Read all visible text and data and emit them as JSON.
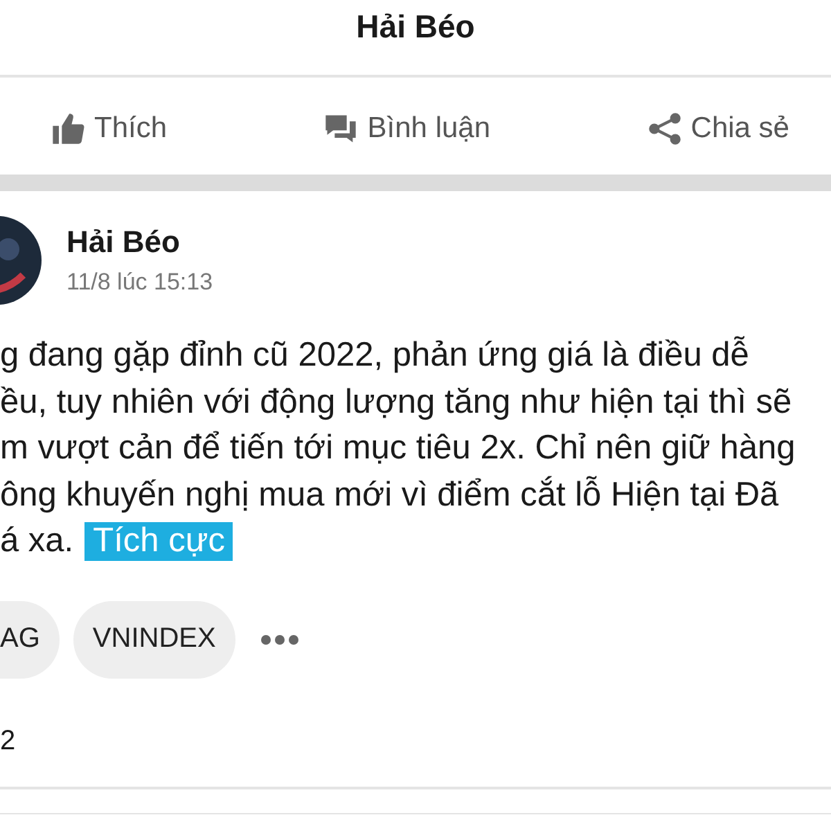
{
  "header": {
    "title": "Hải Béo"
  },
  "actions": [
    {
      "kind": "like",
      "label": "Thích"
    },
    {
      "kind": "comment",
      "label": "Bình luận"
    },
    {
      "kind": "share",
      "label": "Chia sẻ"
    }
  ],
  "post": {
    "author": "Hải Béo",
    "time": "11/8 lúc 15:13",
    "lines": [
      "g đang gặp đỉnh cũ 2022, phản ứng giá là điều dễ",
      "ều, tuy nhiên với động lượng tăng như hiện tại thì sẽ",
      "m vượt cản để tiến tới mục tiêu 2x. Chỉ nên giữ hàng",
      "ông khuyến nghị mua mới vì điểm cắt lỗ Hiện tại Đã",
      "á xa."
    ],
    "sentiment": "Tích cực",
    "tags": [
      "AG",
      "VNINDEX"
    ],
    "count": "2"
  }
}
